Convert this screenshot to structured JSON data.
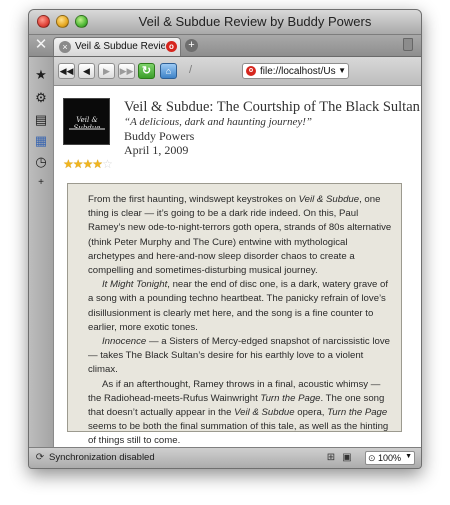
{
  "window": {
    "title": "Veil & Subdue Review by Buddy Powers"
  },
  "tabs": [
    {
      "label": "Veil & Subdue Review ...",
      "favicon": "opera-icon"
    }
  ],
  "toolbar": {
    "back_label": "◀◀",
    "prev_label": "◀",
    "next_label": "▶",
    "fastforward_label": "▶▶",
    "reload_label": "↻",
    "home_label": "⌂",
    "edit_label": "/"
  },
  "address": {
    "url": "file://localhost/Us"
  },
  "sidebar": {
    "items": [
      {
        "name": "bookmarks-icon",
        "glyph": "★"
      },
      {
        "name": "settings-icon",
        "glyph": "⚙"
      },
      {
        "name": "chat-icon",
        "glyph": "▤"
      },
      {
        "name": "feeds-icon",
        "glyph": "▦"
      },
      {
        "name": "history-icon",
        "glyph": "◷"
      },
      {
        "name": "add-panel-icon",
        "glyph": "+"
      }
    ]
  },
  "album": {
    "cover_text": "Veil & Subdue",
    "title": "Veil & Subdue: The Courtship of The Black Sultan",
    "quote": "“A delicious, dark and haunting journey!”",
    "author": "Buddy Powers",
    "date": "April 1, 2009",
    "rating": 4,
    "rating_max": 5
  },
  "review": {
    "p1_a": "From the first haunting, windswept keystrokes on ",
    "p1_b": "Veil & Subdue",
    "p1_c": ", one thing is clear — it’s going to be a dark ride indeed. On this, Paul Ramey’s new ode-to-night-terrors goth opera, strands of 80s alternative (think Peter Murphy and The Cure) entwine with mythological archetypes and here-and-now sleep disorder chaos to create a compelling and sometimes-disturbing musical journey.",
    "p2_a": "It Might Tonight",
    "p2_b": ", near the end of disc one, is a dark, watery grave of a song with a pounding techno heartbeat. The panicky refrain of love’s disillusionment is clearly met here, and the song is a fine counter to earlier, more exotic tones.",
    "p3_a": "Innocence",
    "p3_b": " — a Sisters of Mercy-edged snapshot of narcissistic love — takes The Black Sultan’s desire for his earthly love to a violent climax.",
    "p4_a": "As if an afterthought, Ramey throws in a final, acoustic whimsy — the Radiohead-meets-Rufus Wainwright ",
    "p4_b": "Turn the Page",
    "p4_c": ". The one song that doesn’t actually appear in the ",
    "p4_d": "Veil & Subdue",
    "p4_e": " opera, ",
    "p4_f": "Turn the Page",
    "p4_g": " seems to be both the final summation of this tale, as well as the hinting of things still to come."
  },
  "status": {
    "sync_text": "Synchronization disabled",
    "zoom": "100%"
  }
}
